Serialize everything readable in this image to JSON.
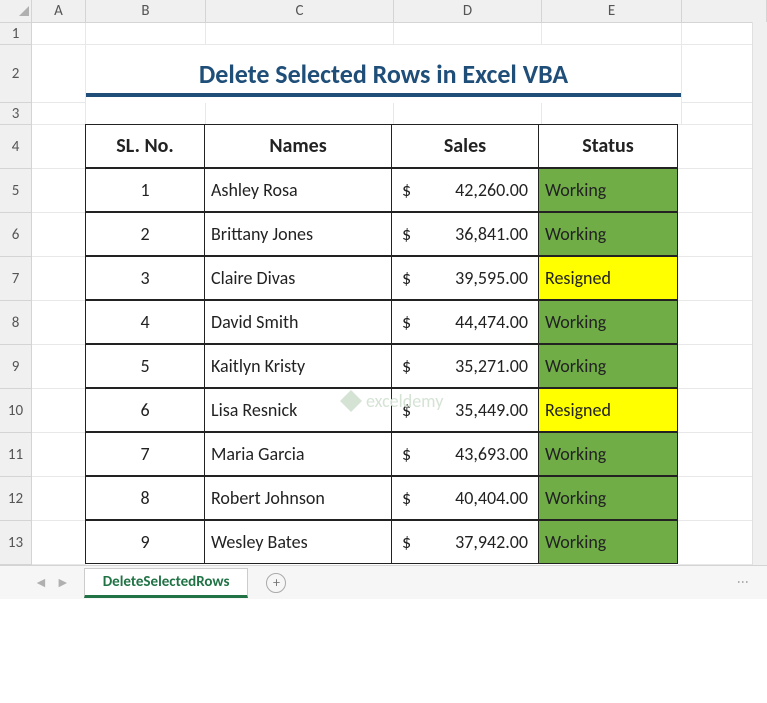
{
  "columns": [
    "A",
    "B",
    "C",
    "D",
    "E"
  ],
  "row_numbers": [
    "1",
    "2",
    "3",
    "4",
    "5",
    "6",
    "7",
    "8",
    "9",
    "10",
    "11",
    "12",
    "13"
  ],
  "row_heights": {
    "r1": 22,
    "r2": 58,
    "r3": 22,
    "data": 44
  },
  "title": "Delete Selected Rows in Excel VBA",
  "headers": {
    "sl": "SL. No.",
    "names": "Names",
    "sales": "Sales",
    "status": "Status"
  },
  "currency": "$",
  "records": [
    {
      "sl": "1",
      "name": "Ashley Rosa",
      "sales": "42,260.00",
      "status": "Working",
      "status_class": "status-working"
    },
    {
      "sl": "2",
      "name": "Brittany Jones",
      "sales": "36,841.00",
      "status": "Working",
      "status_class": "status-working"
    },
    {
      "sl": "3",
      "name": "Claire Divas",
      "sales": "39,595.00",
      "status": "Resigned",
      "status_class": "status-resigned"
    },
    {
      "sl": "4",
      "name": "David Smith",
      "sales": "44,474.00",
      "status": "Working",
      "status_class": "status-working"
    },
    {
      "sl": "5",
      "name": "Kaitlyn Kristy",
      "sales": "35,271.00",
      "status": "Working",
      "status_class": "status-working"
    },
    {
      "sl": "6",
      "name": "Lisa Resnick",
      "sales": "35,449.00",
      "status": "Resigned",
      "status_class": "status-resigned"
    },
    {
      "sl": "7",
      "name": "Maria Garcia",
      "sales": "43,693.00",
      "status": "Working",
      "status_class": "status-working"
    },
    {
      "sl": "8",
      "name": "Robert Johnson",
      "sales": "40,404.00",
      "status": "Working",
      "status_class": "status-working"
    },
    {
      "sl": "9",
      "name": "Wesley Bates",
      "sales": "37,942.00",
      "status": "Working",
      "status_class": "status-working"
    }
  ],
  "tab_name": "DeleteSelectedRows",
  "watermark": "exceldemy"
}
